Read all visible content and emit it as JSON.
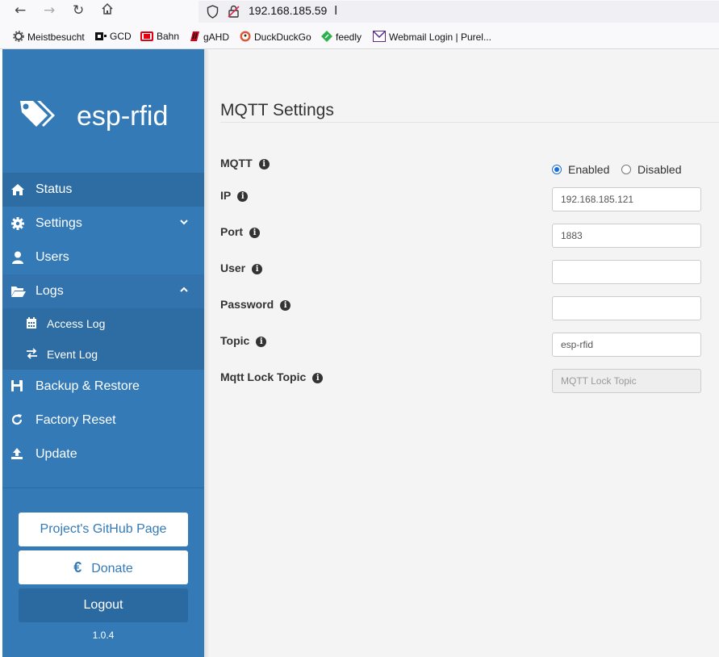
{
  "browser": {
    "url": "192.168.185.59",
    "bookmarks": [
      "Meistbesucht",
      "GCD",
      "Bahn",
      "gAHD",
      "DuckDuckGo",
      "feedly",
      "Webmail Login | Purel..."
    ]
  },
  "sidebar": {
    "brand": "esp-rfid",
    "nav": {
      "status": "Status",
      "settings": "Settings",
      "users": "Users",
      "logs": "Logs",
      "access_log": "Access Log",
      "event_log": "Event Log",
      "backup": "Backup & Restore",
      "factory_reset": "Factory Reset",
      "update": "Update"
    },
    "github_label": "Project's GitHub Page",
    "donate_symbol": "€",
    "donate_label": "Donate",
    "logout_label": "Logout",
    "version": "1.0.4"
  },
  "main": {
    "title": "MQTT Settings",
    "mqtt_label": "MQTT",
    "enabled_label": "Enabled",
    "disabled_label": "Disabled",
    "mqtt_enabled": true,
    "fields": {
      "ip": {
        "label": "IP",
        "value": "192.168.185.121"
      },
      "port": {
        "label": "Port",
        "value": "1883"
      },
      "user": {
        "label": "User",
        "value": ""
      },
      "password": {
        "label": "Password",
        "value": ""
      },
      "topic": {
        "label": "Topic",
        "value": "esp-rfid"
      },
      "lock_topic": {
        "label": "Mqtt Lock Topic",
        "placeholder": "MQTT Lock Topic"
      }
    }
  },
  "colors": {
    "sidebar": "#337ab7",
    "sidebar_active": "#2d6da3",
    "accent": "#1a6fd6"
  }
}
